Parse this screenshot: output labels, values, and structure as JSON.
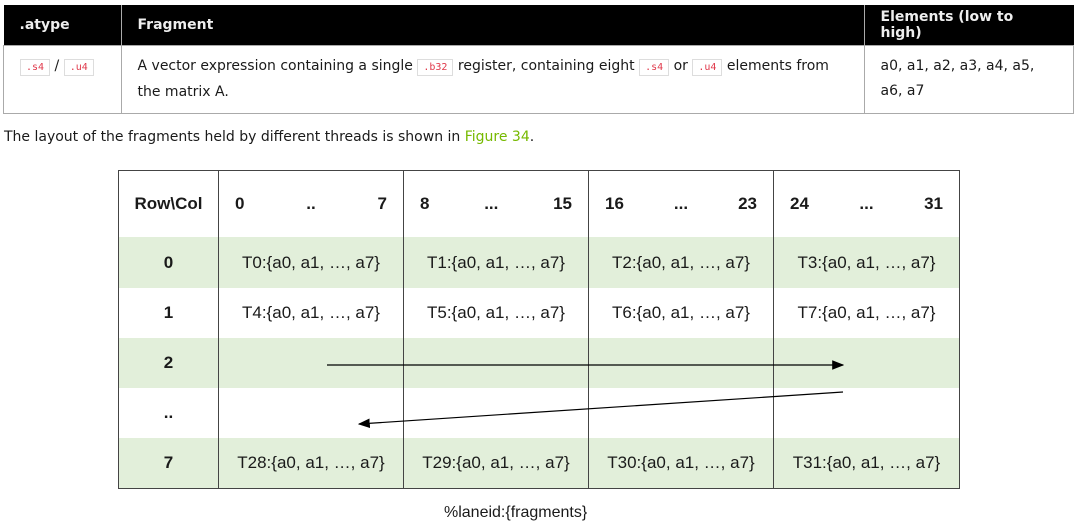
{
  "doc_table": {
    "headers": [
      ".atype",
      "Fragment",
      "Elements (low to high)"
    ],
    "row": {
      "atype_a": ".s4",
      "atype_sep": "/",
      "atype_b": ".u4",
      "frag_1": "A vector expression containing a single",
      "frag_code1": ".b32",
      "frag_2": "register, containing eight",
      "frag_code2": ".s4",
      "frag_3": "or",
      "frag_code3": ".u4",
      "frag_4": "elements from the matrix A.",
      "elements": "a0, a1, a2, a3, a4, a5, a6, a7"
    }
  },
  "paragraph": {
    "text": "The layout of the fragments held by different threads is shown in",
    "link": "Figure 34",
    "end": "."
  },
  "figure": {
    "corner": "Row\\Col",
    "col_groups": [
      [
        "0",
        "..",
        "7"
      ],
      [
        "8",
        "...",
        "15"
      ],
      [
        "16",
        "...",
        "23"
      ],
      [
        "24",
        "...",
        "31"
      ]
    ],
    "rows": [
      {
        "label": "0",
        "cells": [
          "T0:{a0, a1, …, a7}",
          "T1:{a0, a1, …, a7}",
          "T2:{a0, a1, …, a7}",
          "T3:{a0, a1, …, a7}"
        ]
      },
      {
        "label": "1",
        "cells": [
          "T4:{a0, a1, …, a7}",
          "T5:{a0, a1, …, a7}",
          "T6:{a0, a1, …, a7}",
          "T7:{a0, a1, …, a7}"
        ]
      },
      {
        "label": "2",
        "cells": [
          "",
          "",
          "",
          ""
        ]
      },
      {
        "label": "..",
        "cells": [
          "",
          "",
          "",
          ""
        ]
      },
      {
        "label": "7",
        "cells": [
          "T28:{a0, a1, …, a7}",
          "T29:{a0, a1, …, a7}",
          "T30:{a0, a1, …, a7}",
          "T31:{a0, a1, …, a7}"
        ]
      }
    ],
    "caption": "%laneid:{fragments}"
  }
}
